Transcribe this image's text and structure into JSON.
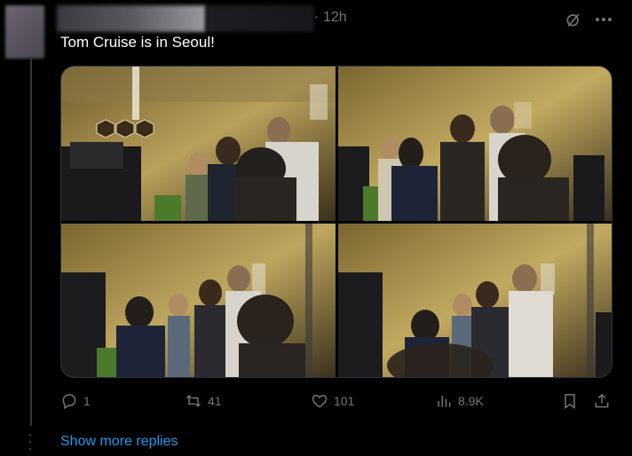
{
  "post": {
    "time": "12h",
    "text": "Tom Cruise is in Seoul!",
    "media": [
      {
        "icon": "photo-1"
      },
      {
        "icon": "photo-2"
      },
      {
        "icon": "photo-3"
      },
      {
        "icon": "photo-4"
      }
    ],
    "actions": {
      "replies": "1",
      "reposts": "41",
      "likes": "101",
      "views": "8.9K"
    }
  },
  "footer": {
    "show_more": "Show more replies"
  },
  "colors": {
    "background": "#000000",
    "muted": "#71767b",
    "accent": "#1d9bf0",
    "text": "#e7e9ea"
  },
  "icons": [
    "grok-icon",
    "more-icon",
    "reply-icon",
    "repost-icon",
    "like-icon",
    "views-icon",
    "bookmark-icon",
    "share-icon"
  ]
}
